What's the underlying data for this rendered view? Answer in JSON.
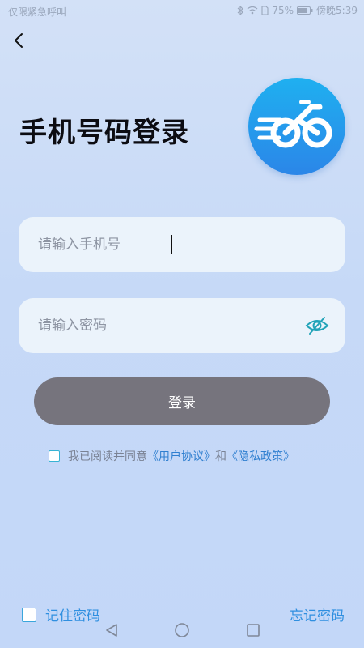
{
  "status_bar": {
    "carrier": "仅限紧急呼叫",
    "battery": "75%",
    "time": "傍晚5:39"
  },
  "header": {
    "title": "手机号码登录"
  },
  "form": {
    "phone": {
      "placeholder": "请输入手机号",
      "value": ""
    },
    "password": {
      "placeholder": "请输入密码",
      "value": ""
    },
    "login_label": "登录"
  },
  "agreement": {
    "prefix": "我已阅读并同意",
    "user_agreement": "《用户协议》",
    "and": "和",
    "privacy_policy": "《隐私政策》",
    "checked": false
  },
  "footer": {
    "remember_label": "记住密码",
    "remember_checked": false,
    "forgot_label": "忘记密码"
  },
  "colors": {
    "accent": "#2f8fe0",
    "login_button": "#76747d",
    "logo_top": "#1fb0f0",
    "logo_bottom": "#2b86e8"
  },
  "icons": [
    "back-arrow-icon",
    "bike-logo-icon",
    "eye-hidden-icon",
    "bluetooth-icon",
    "wifi-icon",
    "battery-icon",
    "nav-back-icon",
    "nav-home-icon",
    "nav-recent-icon"
  ]
}
